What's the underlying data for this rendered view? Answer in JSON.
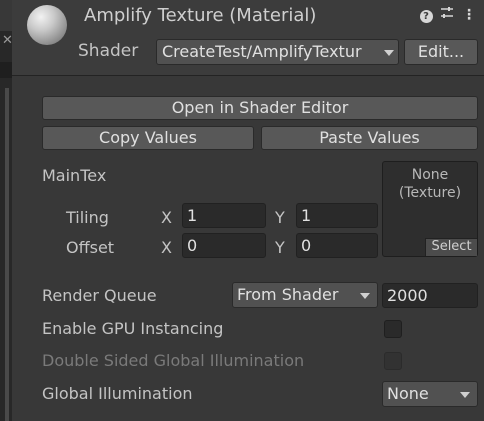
{
  "header": {
    "title": "Amplify Texture (Material)",
    "shader_label": "Shader",
    "shader_value": "CreateTest/AmplifyTextur",
    "edit_label": "Edit...",
    "icons": [
      "help-icon",
      "presets-icon",
      "kebab-menu-icon"
    ]
  },
  "buttons": {
    "open_shader_editor": "Open in Shader Editor",
    "copy_values": "Copy Values",
    "paste_values": "Paste Values"
  },
  "maintex": {
    "label": "MainTex",
    "tiling_label": "Tiling",
    "offset_label": "Offset",
    "x_axis": "X",
    "y_axis": "Y",
    "tiling_x": "1",
    "tiling_y": "1",
    "offset_x": "0",
    "offset_y": "0",
    "texture_none": "None",
    "texture_type": "(Texture)",
    "select_label": "Select"
  },
  "render_queue": {
    "label": "Render Queue",
    "selected": "From Shader",
    "value": "2000"
  },
  "gpu_instancing": {
    "label": "Enable GPU Instancing",
    "checked": false
  },
  "double_sided_gi": {
    "label": "Double Sided Global Illumination",
    "checked": false,
    "disabled": true
  },
  "global_illumination": {
    "label": "Global Illumination",
    "selected": "None"
  },
  "colors": {
    "background": "#383838",
    "header": "#3c3c3c",
    "button": "#585858",
    "field": "#2a2a2a",
    "text": "#c4c4c4",
    "disabled_text": "#7a7a7a"
  }
}
